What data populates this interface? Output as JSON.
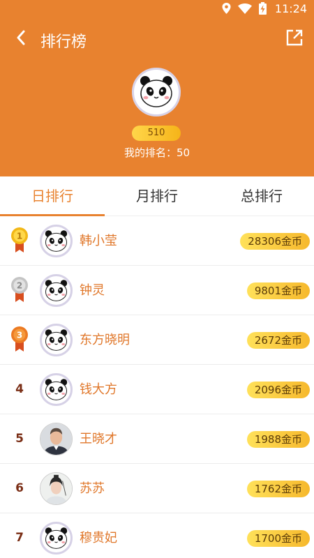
{
  "status_bar": {
    "time": "11:24",
    "icons": [
      "location-icon",
      "wifi-icon",
      "battery-charging-icon"
    ]
  },
  "header": {
    "title": "排行榜",
    "back_icon": "chevron-left-icon",
    "share_icon": "share-external-icon"
  },
  "me": {
    "coins": "510",
    "rank_text": "我的排名：50",
    "avatar": "panda-avatar"
  },
  "colors": {
    "accent": "#e8822f",
    "gold": "#f6b419",
    "rank_text": "#7a2e16",
    "name_text": "#e0772a"
  },
  "tabs": [
    {
      "label": "日排行",
      "active": true
    },
    {
      "label": "月排行",
      "active": false
    },
    {
      "label": "总排行",
      "active": false
    }
  ],
  "leaderboard": [
    {
      "rank": "1",
      "medal": "gold",
      "name": "韩小莹",
      "coins": "28306金币",
      "avatar": "panda"
    },
    {
      "rank": "2",
      "medal": "silver",
      "name": "钟灵",
      "coins": "9801金币",
      "avatar": "panda"
    },
    {
      "rank": "3",
      "medal": "bronze",
      "name": "东方晓明",
      "coins": "2672金币",
      "avatar": "panda"
    },
    {
      "rank": "4",
      "medal": "",
      "name": "钱大方",
      "coins": "2096金币",
      "avatar": "panda"
    },
    {
      "rank": "5",
      "medal": "",
      "name": "王晓才",
      "coins": "1988金币",
      "avatar": "photo-man"
    },
    {
      "rank": "6",
      "medal": "",
      "name": "苏苏",
      "coins": "1762金币",
      "avatar": "photo-costume"
    },
    {
      "rank": "7",
      "medal": "",
      "name": "穆贵妃",
      "coins": "1700金币",
      "avatar": "panda"
    }
  ]
}
